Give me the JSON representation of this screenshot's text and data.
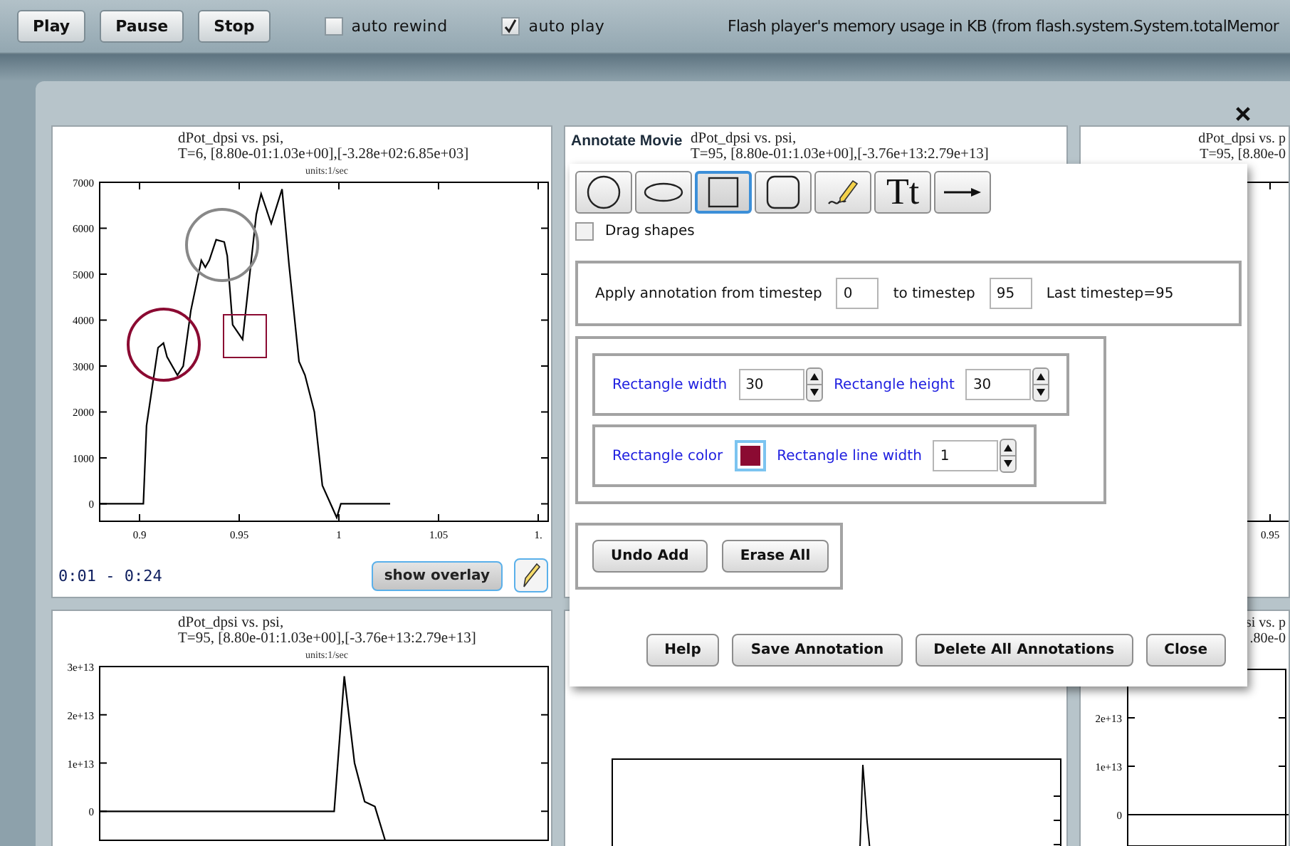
{
  "toolbar": {
    "buttons": [
      "Play",
      "Pause",
      "Stop"
    ],
    "checkboxes": [
      {
        "label": "auto rewind",
        "checked": false
      },
      {
        "label": "auto play",
        "checked": true
      }
    ],
    "memory_label": "Flash player's memory usage in KB (from flash.system.System.totalMemor"
  },
  "panels": [
    {
      "kind": "plot",
      "title_lines": [
        "dPot_dpsi vs. psi,",
        "T=6, [8.80e-01:1.03e+00],[-3.28e+02:6.85e+03]"
      ],
      "units": "units:1/sec",
      "chart_data": {
        "type": "line",
        "xlim": [
          0.88,
          1.105
        ],
        "ylim": [
          -380,
          7000
        ],
        "xticks": [
          0.9,
          0.95,
          1,
          1.05,
          {
            "value": 1.1,
            "label": "1."
          }
        ],
        "yticks": [
          0,
          1000,
          2000,
          3000,
          4000,
          5000,
          6000,
          7000
        ],
        "x": [
          0.88,
          0.9019,
          0.9035,
          0.9093,
          0.912,
          0.9138,
          0.919,
          0.9219,
          0.9257,
          0.931,
          0.933,
          0.935,
          0.9384,
          0.9425,
          0.944,
          0.9467,
          0.9517,
          0.9586,
          0.961,
          0.9661,
          0.9715,
          0.975,
          0.98,
          0.983,
          0.9877,
          0.9917,
          0.9989,
          1.001,
          1.0257
        ],
        "series": [
          {
            "color": "#000000",
            "values": [
              0,
              0,
              1700,
              3400,
              3500,
              3200,
              2800,
              3000,
              4200,
              5300,
              5150,
              5300,
              5750,
              5700,
              5400,
              3900,
              3580,
              6300,
              6750,
              6100,
              6850,
              5200,
              3100,
              2800,
              2000,
              400,
              -300,
              0,
              0
            ]
          }
        ]
      },
      "shapes": [
        {
          "kind": "circle",
          "color": "#8b0a32"
        },
        {
          "kind": "circle",
          "color": "#888888"
        },
        {
          "kind": "rectangle",
          "color": "#8b0a32"
        }
      ],
      "time_range": "0:01 - 0:24",
      "overlay_button": "show overlay",
      "annotate_active": true
    },
    {
      "kind": "plot",
      "title_lines": [
        "dPot_dpsi vs. psi,",
        "T=95, [8.80e-01:1.03e+00],[-3.76e+13:2.79e+13]"
      ]
    },
    {
      "kind": "clipped",
      "title_lines": [
        "dPot_dpsi vs. p",
        "T=95, [8.80e-0"
      ],
      "x_tick_labels": [
        "0.95"
      ]
    },
    {
      "kind": "plot",
      "title_lines": [
        "dPot_dpsi vs. psi,",
        "T=95, [8.80e-01:1.03e+00],[-3.76e+13:2.79e+13]"
      ],
      "units": "units:1/sec",
      "chart_data": {
        "type": "line",
        "ylim": [
          -6000000000000,
          30000000000000
        ],
        "yticks": [
          0,
          {
            "value": 10000000000000,
            "label": "1e+13"
          },
          {
            "value": 20000000000000,
            "label": "2e+13"
          },
          {
            "value": 30000000000000,
            "label": "3e+13"
          }
        ],
        "categories": [
          null,
          null,
          null,
          null,
          null,
          null,
          null,
          null,
          null,
          null,
          null,
          null,
          null,
          null,
          null,
          null,
          null,
          null,
          null,
          null,
          null,
          null,
          null,
          null,
          null,
          null,
          null,
          null,
          null,
          null,
          null,
          null,
          null,
          null,
          null,
          null,
          null,
          null,
          null,
          null,
          null,
          null,
          null,
          null,
          null
        ],
        "series": [
          {
            "color": "#000000",
            "values": [
              0,
              0,
              0,
              0,
              0,
              0,
              0,
              0,
              0,
              0,
              0,
              0,
              0,
              0,
              0,
              0,
              0,
              0,
              0,
              0,
              0,
              0,
              0,
              0,
              28000000000000,
              10000000000000,
              2000000000000,
              1000000000000,
              -6000000000000,
              null,
              null,
              null,
              null,
              null,
              null,
              null,
              null,
              null,
              null,
              null,
              null,
              null,
              null,
              null,
              null
            ]
          }
        ]
      }
    },
    {
      "kind": "covered"
    },
    {
      "kind": "clipped",
      "title_lines": [
        "si vs. p",
        ".80e-0"
      ],
      "y_tick_labels": [
        "2e+13",
        "1e+13",
        "0"
      ]
    }
  ],
  "dialog": {
    "title": "Annotate Movie",
    "tools": [
      {
        "kind": "circle",
        "selected": false
      },
      {
        "kind": "ellipse",
        "selected": false
      },
      {
        "kind": "rectangle",
        "selected": true
      },
      {
        "kind": "rounded",
        "selected": false
      },
      {
        "kind": "pencil",
        "selected": false
      },
      {
        "kind": "text",
        "label": "Tt",
        "selected": false
      },
      {
        "kind": "arrow",
        "selected": false
      }
    ],
    "drag_shapes": {
      "label": "Drag shapes",
      "checked": false
    },
    "timestep": {
      "from_label": "Apply annotation from timestep",
      "from_value": "0",
      "to_label": "to timestep",
      "to_value": "95",
      "last_label": "Last timestep=95"
    },
    "properties": [
      [
        {
          "kind": "spinner",
          "label": "Rectangle width",
          "value": "30"
        },
        {
          "kind": "spinner",
          "label": "Rectangle height",
          "value": "30"
        }
      ],
      [
        {
          "kind": "color",
          "label": "Rectangle color",
          "color": "#8b0a32"
        },
        {
          "kind": "spinner",
          "label": "Rectangle line width",
          "value": "1"
        }
      ]
    ],
    "edit_buttons": [
      "Undo Add",
      "Erase All"
    ],
    "footer_buttons": [
      "Help",
      "Save Annotation",
      "Delete All Annotations",
      "Close"
    ]
  }
}
